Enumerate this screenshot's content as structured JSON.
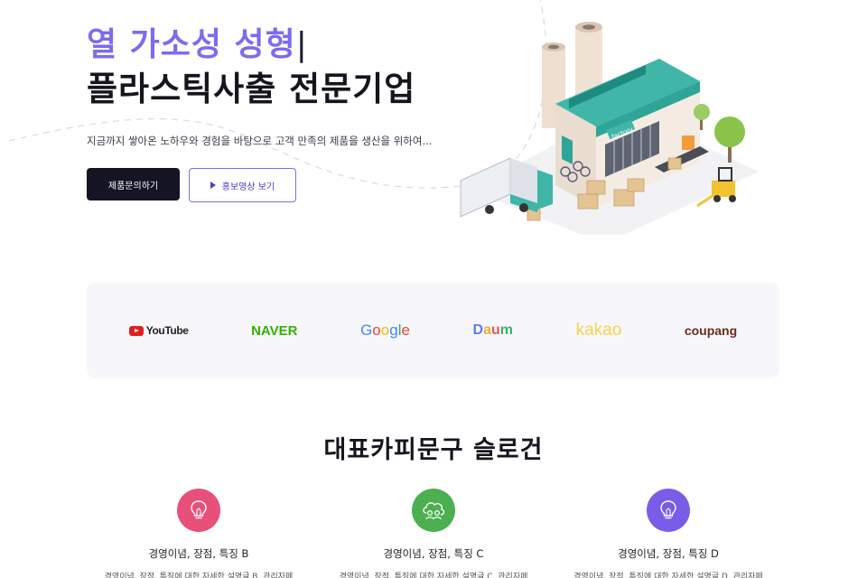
{
  "hero": {
    "accent": "열 가소성 성형",
    "caret": "|",
    "title": "플라스틱사출 전문기업",
    "description": "지금까지 쌓아온 노하우와 경험을 바탕으로 고객 만족의 제품을 생산을 위하여...",
    "primary_button": "제품문의하기",
    "video_button": "홍보영상 보기",
    "illustration_sign": "factory"
  },
  "partners": {
    "logos": [
      {
        "name": "YouTube",
        "icon": "youtube-play-icon"
      },
      {
        "name": "NAVER"
      },
      {
        "name": "Google"
      },
      {
        "name": "Daum"
      },
      {
        "name": "kakao"
      },
      {
        "name": "coupang"
      }
    ]
  },
  "slogan": "대표카피문구 슬로건",
  "features": [
    {
      "title": "경영이념, 장점, 특징 B",
      "desc": "경영이념, 장점, 특징에 대한 자세한 설명글 B, 관리자페",
      "color": "#e8507a",
      "icon": "lightbulb-icon"
    },
    {
      "title": "경영이념, 장점, 특징 C",
      "desc": "경영이념, 장점, 특징에 대한 자세한 설명글 C, 관리자페",
      "color": "#4caf50",
      "icon": "people-cloud-icon"
    },
    {
      "title": "경영이념, 장점, 특징 D",
      "desc": "경영이념, 장점, 특징에 대한 자세한 설명글 D, 관리자페",
      "color": "#7b5ce8",
      "icon": "lightbulb-icon"
    }
  ],
  "colors": {
    "accent": "#7b6cf0",
    "dark": "#141424",
    "logo_band": "#f7f7fb"
  }
}
